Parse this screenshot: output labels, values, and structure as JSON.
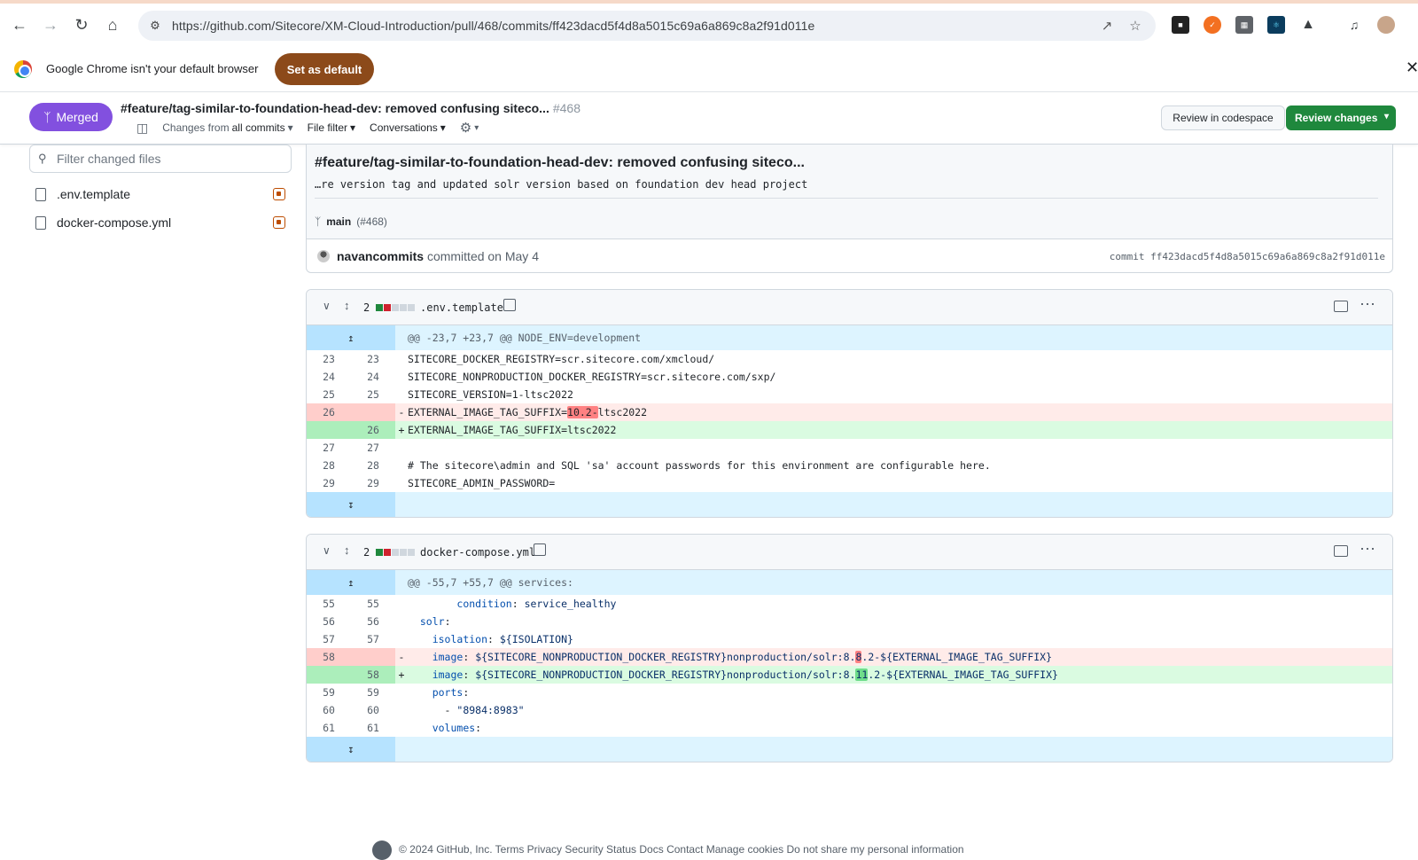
{
  "browser": {
    "url": "https://github.com/Sitecore/XM-Cloud-Introduction/pull/468/commits/ff423dacd5f4d8a5015c69a6a869c8a2f91d011e",
    "infobar_message": "Google Chrome isn't your default browser",
    "set_default_label": "Set as default"
  },
  "pr": {
    "status": "Merged",
    "title": "#feature/tag-similar-to-foundation-head-dev: removed confusing siteco...",
    "number": "#468",
    "changes_from_prefix": "Changes from",
    "changes_from_value": "all commits",
    "file_filter": "File filter",
    "conversations": "Conversations",
    "review_codespace": "Review in codespace",
    "review_changes": "Review changes"
  },
  "filetree": {
    "placeholder": "Filter changed files",
    "files": [
      ".env.template",
      "docker-compose.yml"
    ]
  },
  "commit": {
    "title": "#feature/tag-similar-to-foundation-head-dev: removed confusing siteco...",
    "description": "…re version tag and updated solr version based on foundation dev head project",
    "branch": "main",
    "branch_pr": "(#468)",
    "author": "navancommits",
    "committed": "committed on May 4",
    "sha": "commit ff423dacd5f4d8a5015c69a6a869c8a2f91d011e"
  },
  "diffs": [
    {
      "count": "2",
      "filename": ".env.template",
      "hunk": "@@ -23,7 +23,7 @@ NODE_ENV=development"
    },
    {
      "count": "2",
      "filename": "docker-compose.yml",
      "hunk": "@@ -55,7 +55,7 @@ services:"
    }
  ],
  "footer": {
    "text": "© 2024 GitHub, Inc.   Terms   Privacy   Security   Status   Docs   Contact   Manage cookies   Do not share my personal information"
  },
  "colors": {
    "merged": "#8250df",
    "review_button": "#1f883d",
    "set_default": "#8c4a1a"
  }
}
